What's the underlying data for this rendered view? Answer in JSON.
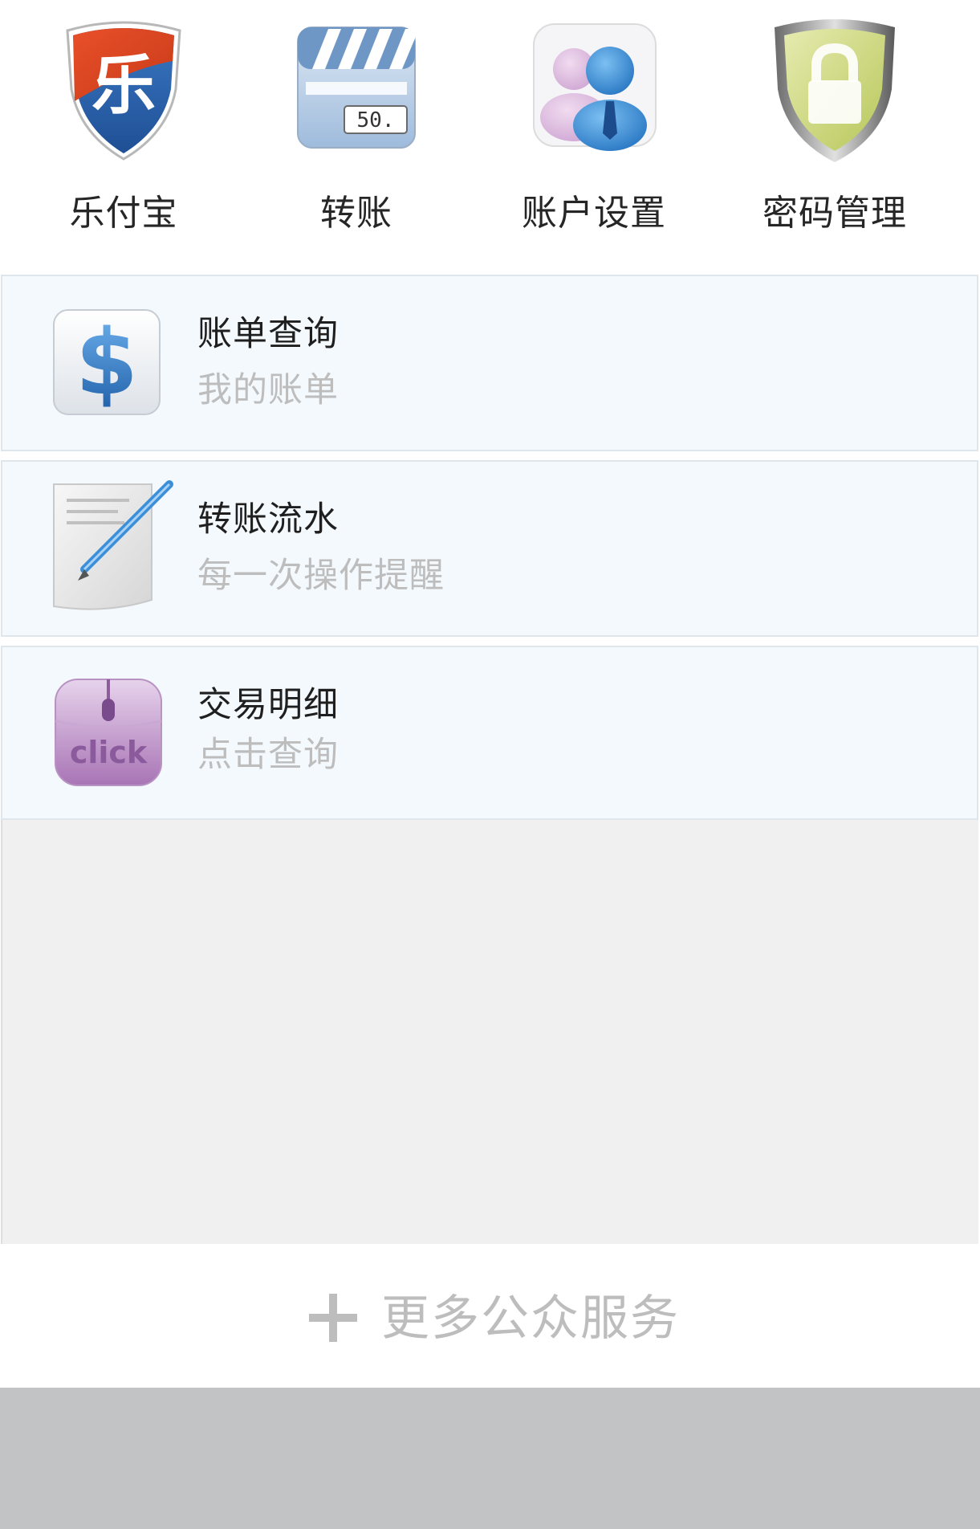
{
  "menu": {
    "items": [
      {
        "label": "乐付宝",
        "icon": "lefubao-shield-icon",
        "glyph": "乐"
      },
      {
        "label": "转账",
        "icon": "clapperboard-icon",
        "amount": "50."
      },
      {
        "label": "账户设置",
        "icon": "users-icon"
      },
      {
        "label": "密码管理",
        "icon": "lock-shield-icon"
      }
    ]
  },
  "list": {
    "items": [
      {
        "title": "账单查询",
        "subtitle": "我的账单",
        "icon": "dollar-icon"
      },
      {
        "title": "转账流水",
        "subtitle": "每一次操作提醒",
        "icon": "document-pen-icon"
      },
      {
        "title": "交易明细",
        "subtitle": "点击查询",
        "icon": "click-mouse-icon",
        "icon_text": "click"
      }
    ]
  },
  "more_services": {
    "label": "更多公众服务",
    "icon": "plus-icon"
  },
  "colors": {
    "card_background": "#f4f9fd",
    "empty_background": "#f0f0f0",
    "bottom_bar": "#c2c3c5",
    "subtitle_text": "#bdbdbd"
  }
}
